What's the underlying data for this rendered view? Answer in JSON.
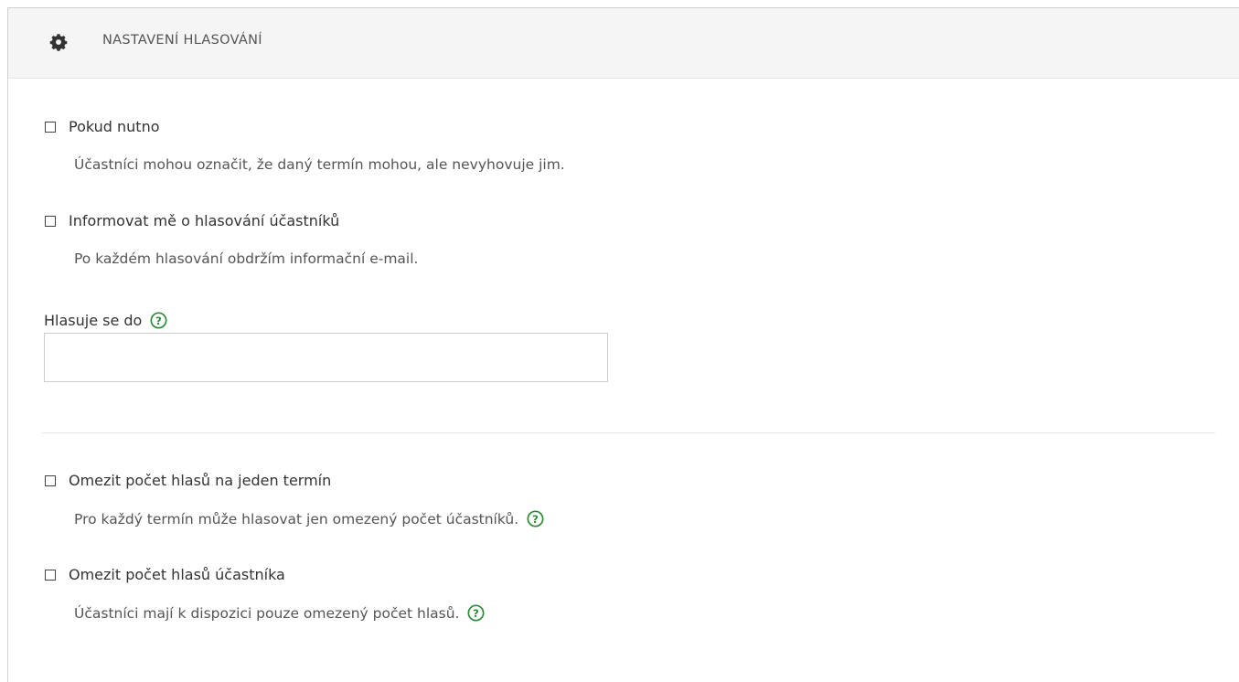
{
  "panel": {
    "title": "NASTAVENÍ HLASOVÁNÍ",
    "icon": "gear-icon"
  },
  "options": {
    "if_needed": {
      "label": "Pokud nutno",
      "description": "Účastníci mohou označit, že daný termín mohou, ale nevyhovuje jim.",
      "checked": false
    },
    "notify": {
      "label": "Informovat mě o hlasování účastníků",
      "description": "Po každém hlasování obdržím informační e-mail.",
      "checked": false
    },
    "limit_per_slot": {
      "label": "Omezit počet hlasů na jeden termín",
      "description": "Pro každý termín může hlasovat jen omezený počet účastníků.",
      "checked": false
    },
    "limit_per_participant": {
      "label": "Omezit počet hlasů účastníka",
      "description": "Účastníci mají k dispozici pouze omezený počet hlasů.",
      "checked": false
    }
  },
  "deadline": {
    "label": "Hlasuje se do",
    "value": "",
    "placeholder": ""
  },
  "colors": {
    "help_green": "#2e8b3a",
    "header_bg": "#f5f5f5"
  }
}
